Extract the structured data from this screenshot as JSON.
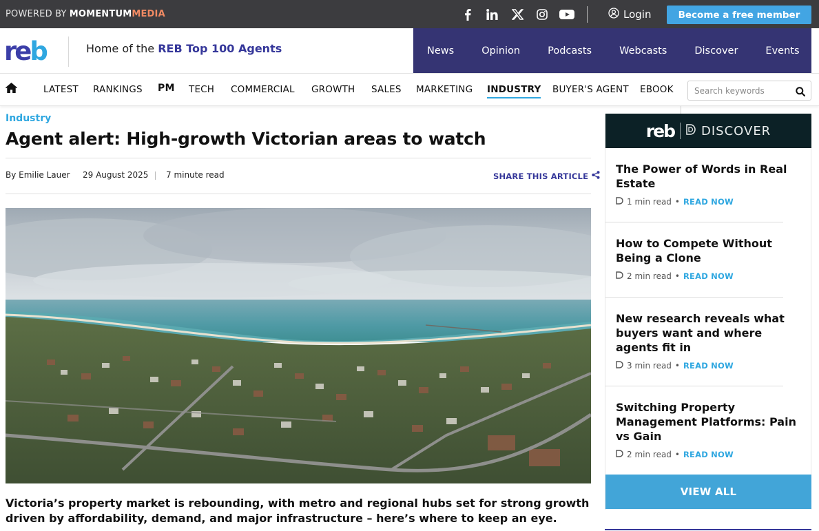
{
  "topbar": {
    "powered_prefix": "POWERED BY",
    "brand_a": "MOMENTUM",
    "brand_b": "MEDIA",
    "social_icons": [
      "facebook-icon",
      "linkedin-icon",
      "x-icon",
      "instagram-icon",
      "youtube-icon"
    ],
    "login_label": "Login",
    "cta_label": "Become a free member"
  },
  "header": {
    "logo_letters": [
      "r",
      "e",
      "b"
    ],
    "tagline_prefix": "Home of the",
    "tagline_highlight": "REB Top 100 Agents",
    "main_nav": [
      "News",
      "Opinion",
      "Podcasts",
      "Webcasts",
      "Discover",
      "Events"
    ]
  },
  "subnav": {
    "items": [
      "LATEST",
      "RANKINGS",
      "PM",
      "TECH",
      "COMMERCIAL",
      "GROWTH",
      "SALES",
      "MARKETING",
      "INDUSTRY",
      "BUYER'S AGENT",
      "EBOOK"
    ],
    "active": "INDUSTRY",
    "search_placeholder": "Search keywords"
  },
  "article": {
    "category": "Industry",
    "title": "Agent alert: High-growth Victorian areas to watch",
    "author": "By Emilie Lauer",
    "date": "29 August 2025",
    "read_time": "7 minute read",
    "share_label": "SHARE THIS ARTICLE",
    "lead": "Victoria’s property market is rebounding, with metro and regional hubs set for strong growth driven by affordability, demand, and major infrastructure – here’s where to keep an eye."
  },
  "sidebar": {
    "header_logo": "reb",
    "header_label": "DISCOVER",
    "cards": [
      {
        "title": "The Power of Words in Real Estate",
        "read": "1 min read",
        "cta": "READ NOW"
      },
      {
        "title": "How to Compete Without Being a Clone",
        "read": "2 min read",
        "cta": "READ NOW"
      },
      {
        "title": "New research reveals what buyers want and where agents fit in",
        "read": "3 min read",
        "cta": "READ NOW"
      },
      {
        "title": "Switching Property Management Platforms: Pain vs Gain",
        "read": "2 min read",
        "cta": "READ NOW"
      }
    ],
    "view_all": "VIEW ALL"
  },
  "colors": {
    "accent": "#2fa7e0",
    "brand_navy": "#353473",
    "topbar": "#3c3c3f",
    "cta": "#42a5e3"
  }
}
